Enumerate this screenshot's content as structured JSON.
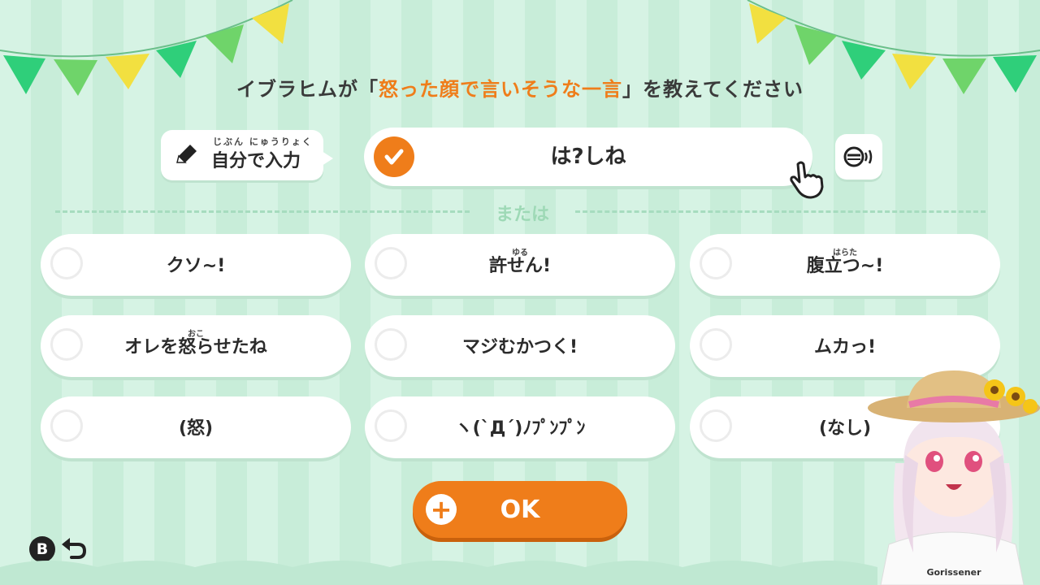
{
  "prompt": {
    "prefix": "イブラヒムが「",
    "highlight": "怒った顔で言いそうな一言",
    "suffix": "」を教えてください"
  },
  "self_input": {
    "ruby": "じぶん にゅうりょく",
    "label": "自分で入力"
  },
  "answer": {
    "text": "は?しね"
  },
  "divider_label": "または",
  "choices": [
    {
      "label": "クソ~!",
      "ruby": ""
    },
    {
      "label": "許せん!",
      "ruby": "ゆる"
    },
    {
      "label": "腹立つ~!",
      "ruby": "はらた"
    },
    {
      "label": "オレを怒らせたね",
      "ruby": "おこ"
    },
    {
      "label": "マジむかつく!",
      "ruby": ""
    },
    {
      "label": "ムカっ!",
      "ruby": ""
    },
    {
      "label": "(怒)",
      "ruby": ""
    },
    {
      "label": "ヽ(`Д´)ﾉﾌﾟﾝﾌﾟﾝ",
      "ruby": ""
    },
    {
      "label": "(なし)",
      "ruby": ""
    }
  ],
  "ok_button": {
    "label": "OK",
    "icon": "plus-icon"
  },
  "back_button": {
    "label": "B",
    "icon": "back-arrow-icon"
  },
  "avatar": {
    "shirt_text": "Gorissener"
  },
  "colors": {
    "accent": "#ef7d1a",
    "background": "#d6f3e4",
    "flag_green": "#2fcf7a",
    "flag_yellow": "#f2e040"
  }
}
